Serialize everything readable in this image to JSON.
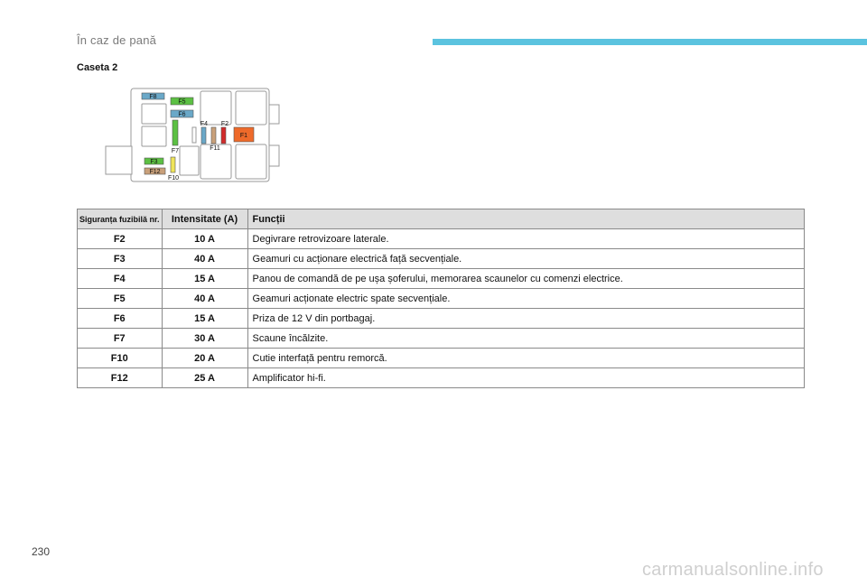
{
  "header": {
    "title": "În caz de pană",
    "accent_color": "#5bc3df"
  },
  "section_title": "Caseta 2",
  "diagram": {
    "labels": {
      "f1": "F1",
      "f2": "F2",
      "f3": "F3",
      "f4": "F4",
      "f5": "F5",
      "f6": "F6",
      "f7": "F7",
      "f8": "F8",
      "f10": "F10",
      "f11": "F11",
      "f12": "F12"
    },
    "colors": {
      "blue": "#6aa8c8",
      "green": "#5cc043",
      "red": "#d12a2a",
      "orange": "#ee6a2a",
      "tan": "#c9a07a",
      "yellow": "#efe45a"
    }
  },
  "table": {
    "headers": [
      "Siguranța fuzibilă nr.",
      "Intensitate (A)",
      "Funcții"
    ],
    "rows": [
      {
        "fuse": "F2",
        "amps": "10 A",
        "function": "Degivrare retrovizoare laterale."
      },
      {
        "fuse": "F3",
        "amps": "40 A",
        "function": "Geamuri cu acționare electrică față secvențiale."
      },
      {
        "fuse": "F4",
        "amps": "15 A",
        "function": "Panou de comandă de pe ușa șoferului, memorarea scaunelor cu comenzi electrice."
      },
      {
        "fuse": "F5",
        "amps": "40 A",
        "function": "Geamuri acționate electric spate secvențiale."
      },
      {
        "fuse": "F6",
        "amps": "15 A",
        "function": "Priza de 12 V din portbagaj."
      },
      {
        "fuse": "F7",
        "amps": "30 A",
        "function": "Scaune încălzite."
      },
      {
        "fuse": "F10",
        "amps": "20 A",
        "function": "Cutie interfață pentru remorcă."
      },
      {
        "fuse": "F12",
        "amps": "25 A",
        "function": "Amplificator hi-fi."
      }
    ]
  },
  "page_number": "230",
  "watermark": "carmanualsonline.info"
}
